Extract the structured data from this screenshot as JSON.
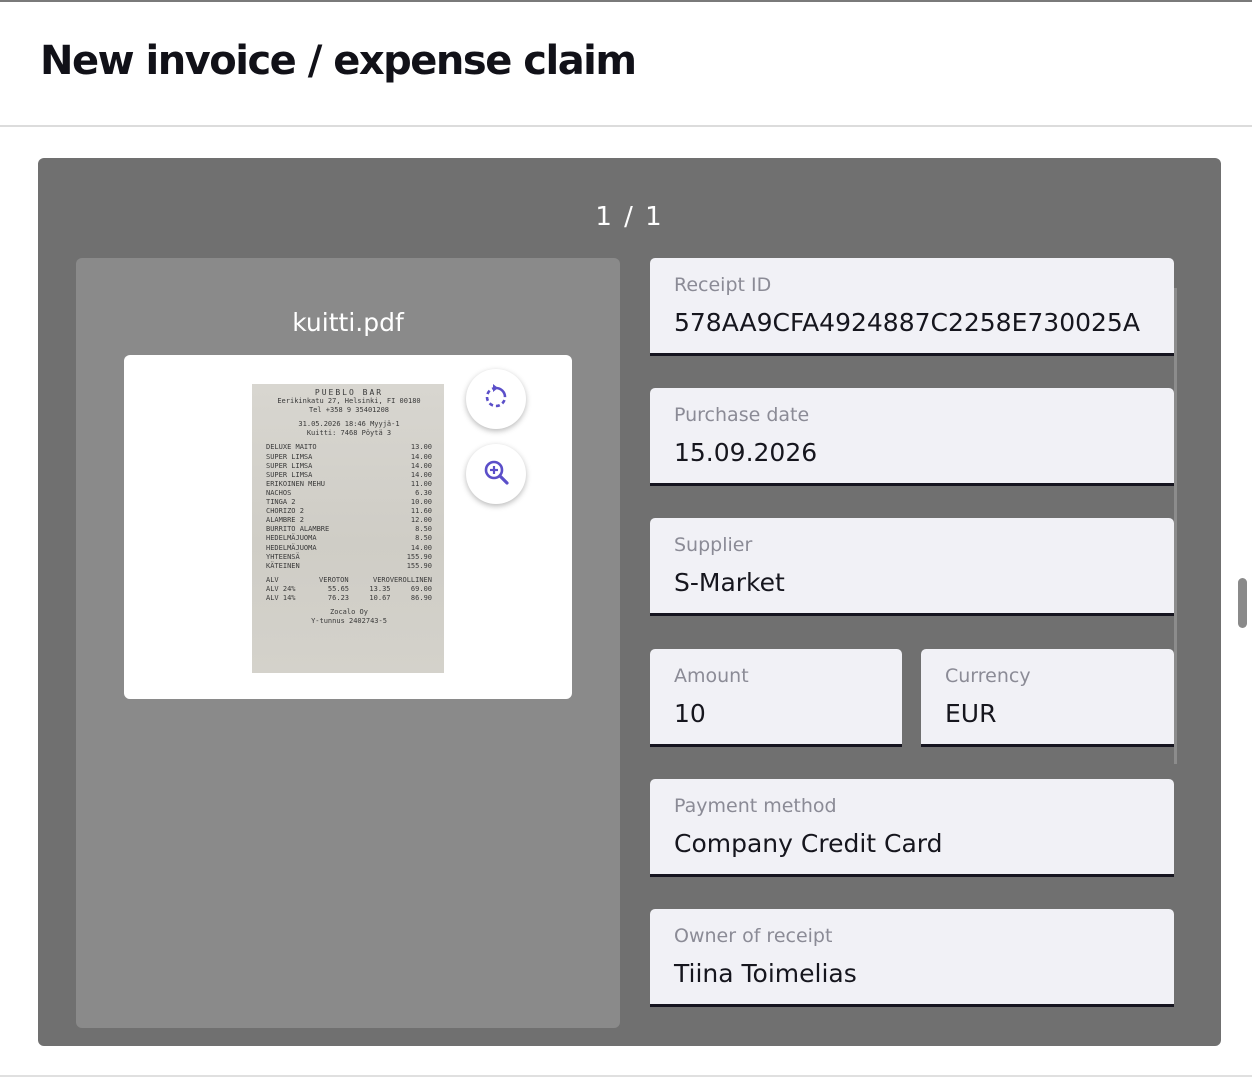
{
  "header": {
    "title": "New invoice / expense claim"
  },
  "viewer": {
    "page_indicator": "1 / 1"
  },
  "file": {
    "name": "kuitti.pdf",
    "receipt": {
      "store": "PUEBLO BAR",
      "address": "Eerikinkatu 27, Helsinki, FI 00180",
      "phone": "Tel +358 9 35401208",
      "datetime_line": "31.05.2026 18:46 Myyjä-1",
      "receipt_line": "Kuitti: 7468  Pöytä 3",
      "items": [
        {
          "name": "DELUXE MAITO",
          "price": "13.00"
        },
        {
          "name": "SUPER LIMSA",
          "price": "14.00"
        },
        {
          "name": "SUPER LIMSA",
          "price": "14.00"
        },
        {
          "name": "SUPER LIMSA",
          "price": "14.00"
        },
        {
          "name": "ERIKOINEN MEHU",
          "price": "11.00"
        },
        {
          "name": "NACHOS",
          "price": "6.30"
        },
        {
          "name": "TINGA 2",
          "price": "10.00"
        },
        {
          "name": "CHORIZO 2",
          "price": "11.60"
        },
        {
          "name": "ALAMBRE 2",
          "price": "12.00"
        },
        {
          "name": "BURRITO ALAMBRE",
          "price": "8.50"
        },
        {
          "name": "HEDELMÄJUOMA",
          "price": "8.50"
        },
        {
          "name": "HEDELMÄJUOMA",
          "price": "14.00"
        },
        {
          "name": "YHTEENSÄ",
          "price": "155.90"
        },
        {
          "name": "KÄTEINEN",
          "price": "155.90"
        }
      ],
      "vat_header": [
        "ALV",
        "VEROTON",
        "VERO",
        "VEROLLINEN"
      ],
      "vat_rows": [
        [
          "ALV 24%",
          "55.65",
          "13.35",
          "69.00"
        ],
        [
          "ALV 14%",
          "76.23",
          "10.67",
          "86.90"
        ]
      ],
      "company": "Zocalo Oy",
      "business_id": "Y-tunnus 2402743-5"
    }
  },
  "fields": {
    "receipt_id": {
      "label": "Receipt ID",
      "value": "578AA9CFA4924887C2258E730025A"
    },
    "purchase_date": {
      "label": "Purchase date",
      "value": "15.09.2026"
    },
    "supplier": {
      "label": "Supplier",
      "value": "S-Market"
    },
    "amount": {
      "label": "Amount",
      "value": "10"
    },
    "currency": {
      "label": "Currency",
      "value": "EUR"
    },
    "payment_method": {
      "label": "Payment method",
      "value": "Company Credit Card"
    },
    "owner": {
      "label": "Owner of receipt",
      "value": "Tiina Toimelias"
    }
  },
  "icons": {
    "rotate": "rotate-icon",
    "zoom": "zoom-in-icon",
    "accent": "#5b4fc9"
  }
}
